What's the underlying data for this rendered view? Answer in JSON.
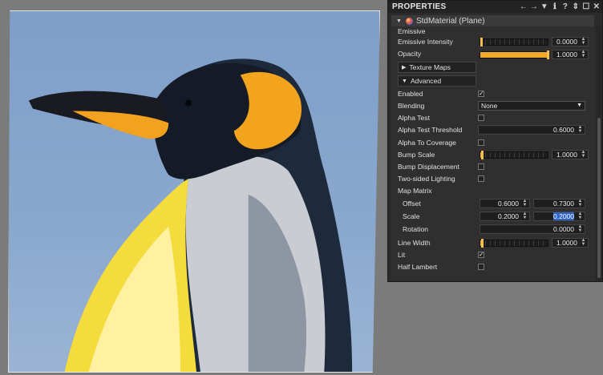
{
  "panel": {
    "title": "PROPERTIES",
    "tools": [
      "←",
      "→",
      "▼",
      "ℹ",
      "?",
      "⇕",
      "☐",
      "✕"
    ],
    "material_title": "StdMaterial (Plane)"
  },
  "props": {
    "emissive_label": "Emissive",
    "emissive_intensity": {
      "label": "Emissive Intensity",
      "value": "0.0000",
      "level": 0.0
    },
    "opacity": {
      "label": "Opacity",
      "value": "1.0000",
      "level": 1.0
    },
    "texture_maps": "Texture Maps",
    "advanced": "Advanced",
    "enabled": {
      "label": "Enabled",
      "checked": true
    },
    "blending": {
      "label": "Blending",
      "value": "None"
    },
    "alpha_test": {
      "label": "Alpha Test",
      "checked": false
    },
    "alpha_test_threshold": {
      "label": "Alpha Test Threshold",
      "value": "0.6000"
    },
    "alpha_to_coverage": {
      "label": "Alpha To Coverage",
      "checked": false
    },
    "bump_scale": {
      "label": "Bump Scale",
      "value": "1.0000",
      "level": 0.02
    },
    "bump_displacement": {
      "label": "Bump Displacement",
      "checked": false
    },
    "two_sided_lighting": {
      "label": "Two-sided Lighting",
      "checked": false
    },
    "map_matrix": "Map Matrix",
    "offset": {
      "label": "Offset",
      "x": "0.6000",
      "y": "0.7300"
    },
    "scale": {
      "label": "Scale",
      "x": "0.2000",
      "y": "0.2000"
    },
    "rotation": {
      "label": "Rotation",
      "value": "0.0000"
    },
    "line_width": {
      "label": "Line Width",
      "value": "1.0000",
      "level": 0.02
    },
    "lit": {
      "label": "Lit",
      "checked": true
    },
    "half_lambert": {
      "label": "Half Lambert",
      "checked": false
    }
  },
  "colors": {
    "accent": "#f0a82c",
    "selection": "#2f63c8",
    "panel_bg": "#2b2b2b"
  }
}
